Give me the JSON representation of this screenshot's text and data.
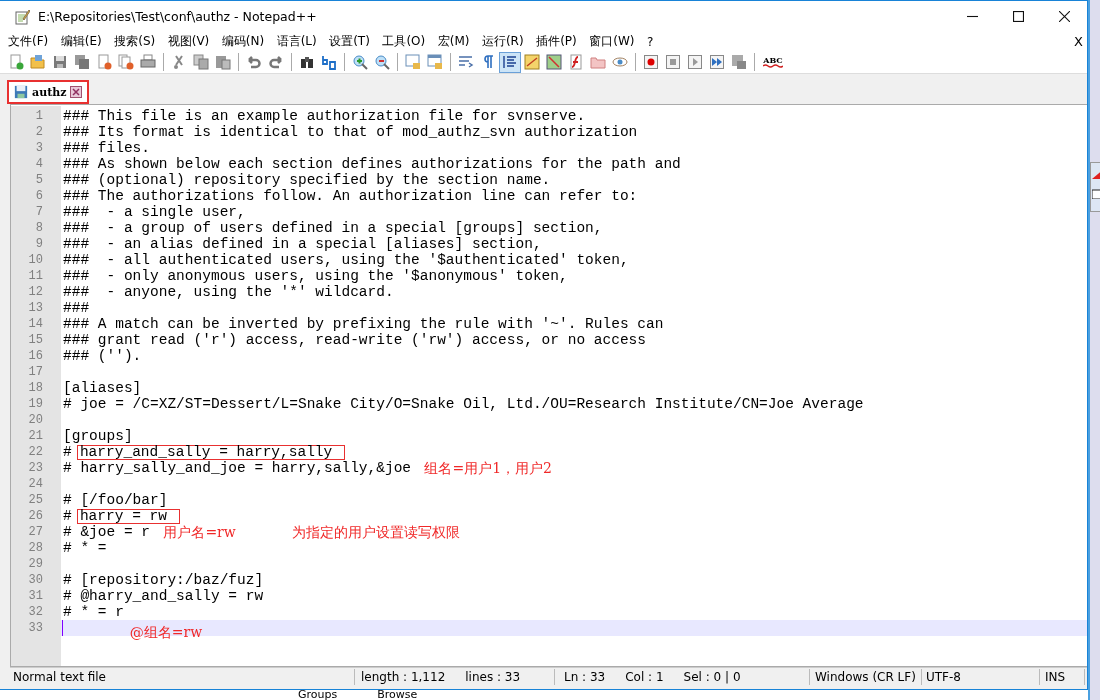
{
  "window": {
    "title": "E:\\Repositories\\Test\\conf\\authz - Notepad++"
  },
  "menu": [
    "文件(F)",
    "编辑(E)",
    "搜索(S)",
    "视图(V)",
    "编码(N)",
    "语言(L)",
    "设置(T)",
    "工具(O)",
    "宏(M)",
    "运行(R)",
    "插件(P)",
    "窗口(W)",
    "?"
  ],
  "menu_close": "X",
  "toolbar": [
    {
      "kind": "new",
      "on": false
    },
    {
      "kind": "open",
      "on": false
    },
    {
      "kind": "save",
      "on": false
    },
    {
      "kind": "saveall",
      "on": false
    },
    {
      "kind": "close",
      "on": false
    },
    {
      "kind": "closeall",
      "on": false
    },
    {
      "kind": "print",
      "on": false
    },
    {
      "kind": "separator"
    },
    {
      "kind": "cut",
      "on": false
    },
    {
      "kind": "copy",
      "on": false
    },
    {
      "kind": "paste",
      "on": false
    },
    {
      "kind": "separator"
    },
    {
      "kind": "undo",
      "on": false
    },
    {
      "kind": "redo",
      "on": false
    },
    {
      "kind": "separator"
    },
    {
      "kind": "find",
      "on": false
    },
    {
      "kind": "replace",
      "on": false
    },
    {
      "kind": "separator"
    },
    {
      "kind": "zoomin",
      "on": false
    },
    {
      "kind": "zoomout",
      "on": false
    },
    {
      "kind": "separator"
    },
    {
      "kind": "syncv",
      "on": false
    },
    {
      "kind": "synch",
      "on": false
    },
    {
      "kind": "separator"
    },
    {
      "kind": "wrap",
      "on": false
    },
    {
      "kind": "allchars",
      "on": false
    },
    {
      "kind": "indent",
      "on": true
    },
    {
      "kind": "udl",
      "on": false
    },
    {
      "kind": "map",
      "on": false
    },
    {
      "kind": "function",
      "on": false
    },
    {
      "kind": "folder",
      "on": false
    },
    {
      "kind": "eye",
      "on": false
    },
    {
      "kind": "separator"
    },
    {
      "kind": "record",
      "on": false
    },
    {
      "kind": "stop",
      "on": false
    },
    {
      "kind": "play",
      "on": false
    },
    {
      "kind": "playmulti",
      "on": false
    },
    {
      "kind": "savemacro",
      "on": false
    },
    {
      "kind": "separator"
    },
    {
      "kind": "spell",
      "on": false,
      "label": "ABC"
    }
  ],
  "tabs": [
    {
      "label": "authz",
      "selected": true,
      "highlighted": true
    }
  ],
  "lines": [
    {
      "number": "1",
      "text": "### This file is an example authorization file for svnserve."
    },
    {
      "number": "2",
      "text": "### Its format is identical to that of mod_authz_svn authorization"
    },
    {
      "number": "3",
      "text": "### files."
    },
    {
      "number": "4",
      "text": "### As shown below each section defines authorizations for the path and"
    },
    {
      "number": "5",
      "text": "### (optional) repository specified by the section name."
    },
    {
      "number": "6",
      "text": "### The authorizations follow. An authorization line can refer to:"
    },
    {
      "number": "7",
      "text": "###  - a single user,"
    },
    {
      "number": "8",
      "text": "###  - a group of users defined in a special [groups] section,"
    },
    {
      "number": "9",
      "text": "###  - an alias defined in a special [aliases] section,"
    },
    {
      "number": "10",
      "text": "###  - all authenticated users, using the '$authenticated' token,"
    },
    {
      "number": "11",
      "text": "###  - only anonymous users, using the '$anonymous' token,"
    },
    {
      "number": "12",
      "text": "###  - anyone, using the '*' wildcard."
    },
    {
      "number": "13",
      "text": "###"
    },
    {
      "number": "14",
      "text": "### A match can be inverted by prefixing the rule with '~'. Rules can"
    },
    {
      "number": "15",
      "text": "### grant read ('r') access, read-write ('rw') access, or no access"
    },
    {
      "number": "16",
      "text": "### ('')."
    },
    {
      "number": "17"
    },
    {
      "number": "18",
      "text": "[aliases]"
    },
    {
      "number": "19",
      "text": "# joe = /C=XZ/ST=Dessert/L=Snake City/O=Snake Oil, Ltd./OU=Research Institute/CN=Joe Average"
    },
    {
      "number": "20"
    },
    {
      "number": "21",
      "text": "[groups]"
    },
    {
      "number": "22",
      "text": "#",
      "boxed_text": "harry_and_sally = harry,sally"
    },
    {
      "number": "23",
      "text": "# harry_sally_and_joe = harry,sally,&joe",
      "notes": [
        "组名=用户1，用户2"
      ]
    },
    {
      "number": "24"
    },
    {
      "number": "25",
      "text": "# [/foo/bar]"
    },
    {
      "number": "26",
      "text": "#",
      "boxed_text": "harry = rw"
    },
    {
      "number": "27",
      "text": "# &joe = r",
      "notes": [
        "用户名=rw",
        "为指定的用户设置读写权限"
      ]
    },
    {
      "number": "28",
      "text": "# * ="
    },
    {
      "number": "29"
    },
    {
      "number": "30",
      "text": "# [repository:/baz/fuz]"
    },
    {
      "number": "31",
      "text": "# @harry_and_sally = rw"
    },
    {
      "number": "32",
      "text": "# * = r"
    },
    {
      "number": "33",
      "current": true,
      "notes": [
        "@组名=rw"
      ]
    }
  ],
  "status_bar": {
    "file_type": "Normal text file",
    "length": "length : 1,112",
    "lines": "lines : 33",
    "ln": "Ln : 33",
    "col": "Col : 1",
    "sel": "Sel : 0 | 0",
    "eol": "Windows (CR LF)",
    "encoding": "UTF-8",
    "mode": "INS"
  },
  "background": {
    "items": [
      "Groups",
      "Browse"
    ]
  }
}
